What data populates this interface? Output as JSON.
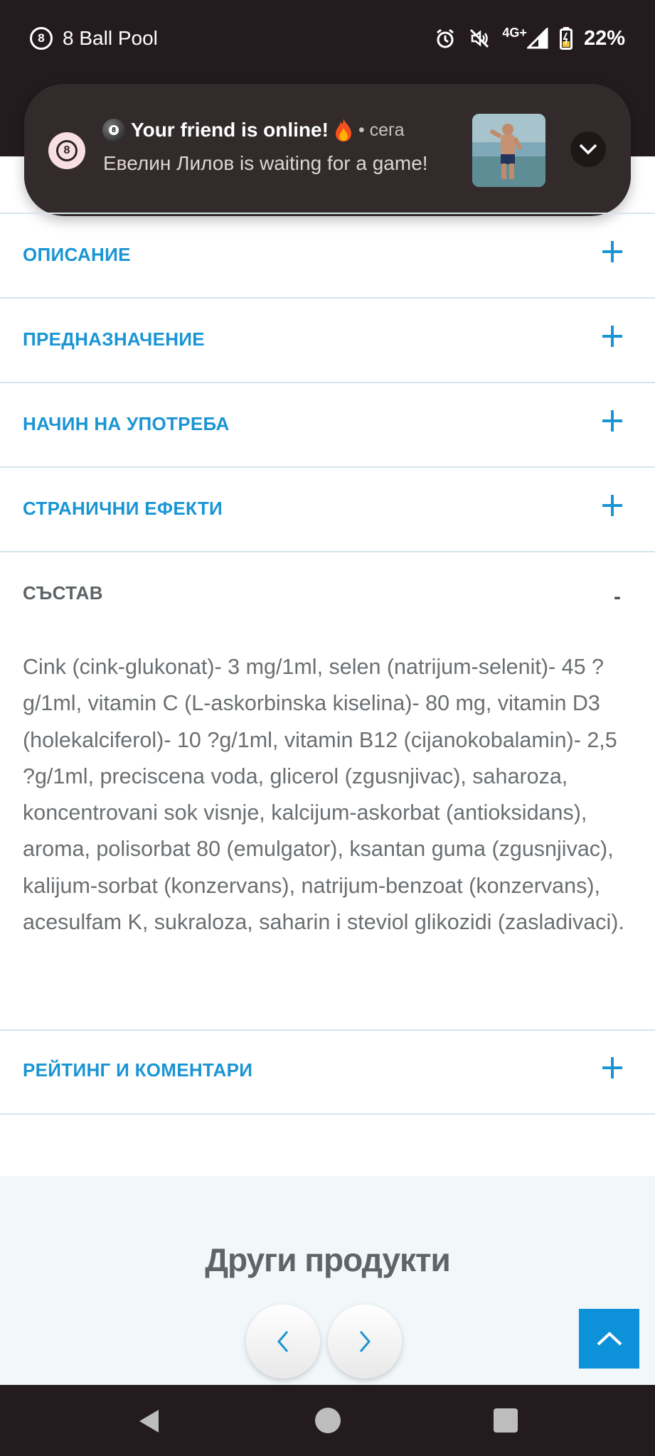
{
  "status_bar": {
    "app_name": "8 Ball Pool",
    "network": "4G+",
    "battery": "22%"
  },
  "notification": {
    "title": "Your friend is online!",
    "time": "• сега",
    "body": "Евелин Лилов is waiting for a game!"
  },
  "accordion": [
    {
      "label": "ОПИСАНИЕ",
      "expanded": false
    },
    {
      "label": "ПРЕДНАЗНАЧЕНИЕ",
      "expanded": false
    },
    {
      "label": "НАЧИН НА УПОТРЕБА",
      "expanded": false
    },
    {
      "label": "СТРАНИЧНИ ЕФЕКТИ",
      "expanded": false
    },
    {
      "label": "СЪСТАВ",
      "expanded": true,
      "toggle": "-",
      "content": "Cink (cink-glukonat)- 3 mg/1ml, selen (natrijum-selenit)- 45 ?g/1ml, vitamin C (L-askorbinska kiselina)- 80 mg, vitamin D3 (holekalciferol)- 10 ?g/1ml, vitamin B12 (cijanokobalamin)- 2,5 ?g/1ml, preciscena voda, glicerol (zgusnjivac), saharoza, koncentrovani sok visnje, kalcijum-askorbat (antioksidans), aroma, polisorbat 80 (emulgator), ksantan guma (zgusnjivac), kalijum-sorbat (konzervans), natrijum-benzoat (konzervans), acesulfam K, sukraloza, saharin i steviol glikozidi (zasladivaci)."
    },
    {
      "label": "РЕЙТИНГ И КОМЕНТАРИ",
      "expanded": false
    }
  ],
  "other_products": {
    "title": "Други продукти"
  },
  "colors": {
    "accent": "#1a95d4",
    "scroll_top": "#0d92da",
    "system_bar": "#231b1d",
    "notification_bg": "#332a2b"
  }
}
